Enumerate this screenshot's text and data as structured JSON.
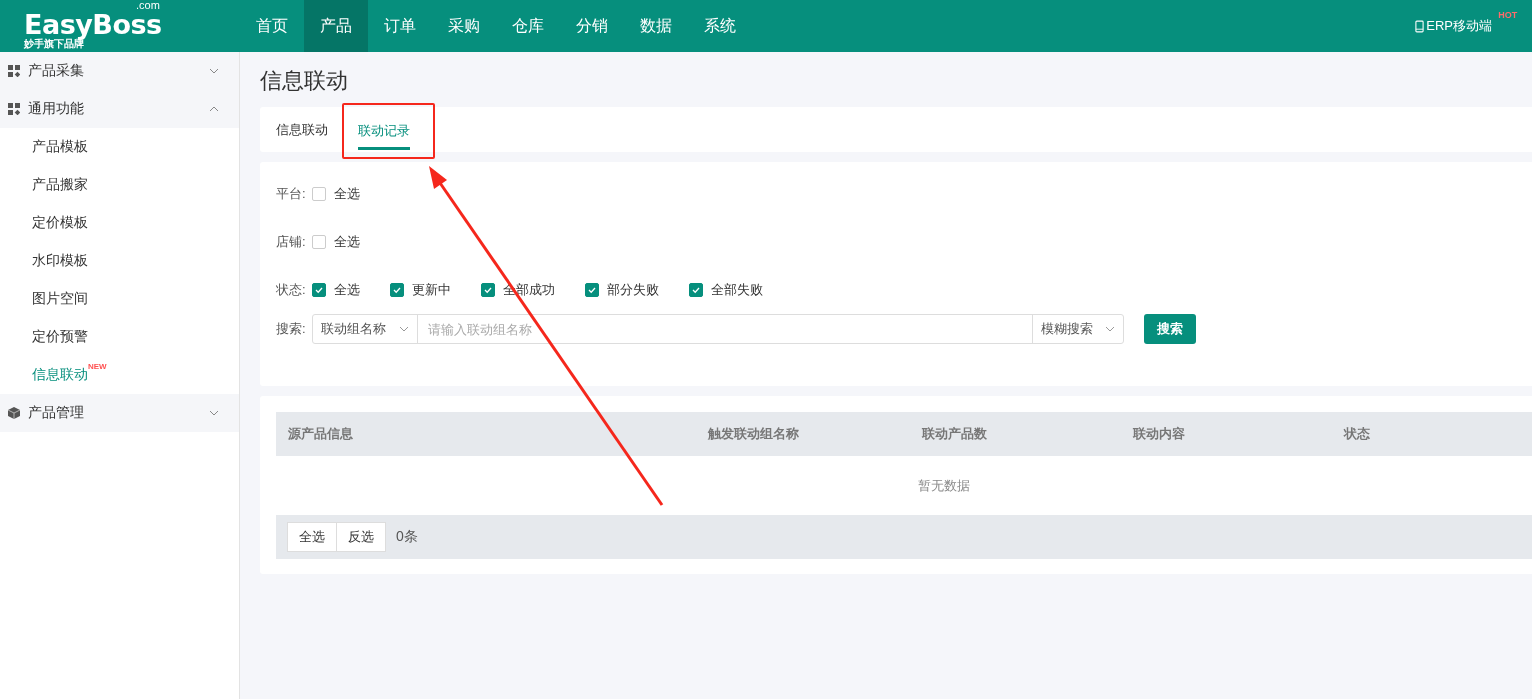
{
  "header": {
    "logo": {
      "name": "EasyBoss",
      "suffix": ".com",
      "tagline": "妙手旗下品牌"
    },
    "nav": [
      {
        "label": "首页",
        "selected": false
      },
      {
        "label": "产品",
        "selected": true
      },
      {
        "label": "订单",
        "selected": false
      },
      {
        "label": "采购",
        "selected": false
      },
      {
        "label": "仓库",
        "selected": false
      },
      {
        "label": "分销",
        "selected": false
      },
      {
        "label": "数据",
        "selected": false
      },
      {
        "label": "系统",
        "selected": false
      }
    ],
    "mobile": {
      "label": "ERP移动端",
      "badge": "HOT"
    }
  },
  "sidebar": {
    "groups": [
      {
        "label": "产品采集",
        "expanded": false
      },
      {
        "label": "通用功能",
        "expanded": true,
        "items": [
          {
            "label": "产品模板",
            "selected": false
          },
          {
            "label": "产品搬家",
            "selected": false
          },
          {
            "label": "定价模板",
            "selected": false
          },
          {
            "label": "水印模板",
            "selected": false
          },
          {
            "label": "图片空间",
            "selected": false
          },
          {
            "label": "定价预警",
            "selected": false
          },
          {
            "label": "信息联动",
            "selected": true,
            "badge": "NEW"
          }
        ]
      },
      {
        "label": "产品管理",
        "expanded": false
      }
    ]
  },
  "page_title": "信息联动",
  "tabs": [
    {
      "label": "信息联动",
      "selected": false
    },
    {
      "label": "联动记录",
      "selected": true
    }
  ],
  "filters": [
    {
      "label": "平台:",
      "options": [
        {
          "label": "全选",
          "checked": false
        }
      ]
    },
    {
      "label": "店铺:",
      "options": [
        {
          "label": "全选",
          "checked": false
        }
      ]
    },
    {
      "label": "状态:",
      "options": [
        {
          "label": "全选",
          "checked": true
        },
        {
          "label": "更新中",
          "checked": true
        },
        {
          "label": "全部成功",
          "checked": true
        },
        {
          "label": "部分失败",
          "checked": true
        },
        {
          "label": "全部失败",
          "checked": true
        }
      ]
    }
  ],
  "search": {
    "label": "搜索:",
    "field": "联动组名称",
    "placeholder": "请输入联动组名称",
    "mode": "模糊搜索",
    "button": "搜索"
  },
  "table": {
    "columns": [
      "源产品信息",
      "触发联动组名称",
      "联动产品数",
      "联动内容",
      "状态"
    ],
    "empty_text": "暂无数据"
  },
  "footer": {
    "buttons": [
      "全选",
      "反选"
    ],
    "count": "0条"
  }
}
